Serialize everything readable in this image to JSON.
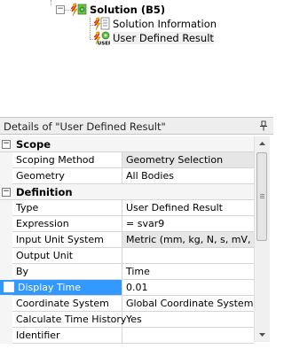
{
  "tree": {
    "solution_label": "Solution (B5)",
    "solution_info_label": "Solution Information",
    "user_result_label": "User Defined Result"
  },
  "details": {
    "title": "Details of \"User Defined Result\""
  },
  "categories": {
    "scope": "Scope",
    "definition": "Definition"
  },
  "rows": [
    {
      "property": "Scoping Method",
      "value": "Geometry Selection"
    },
    {
      "property": "Geometry",
      "value": "All Bodies"
    },
    {
      "property": "Type",
      "value": "User Defined Result"
    },
    {
      "property": "Expression",
      "value": "= svar9"
    },
    {
      "property": "Input Unit System",
      "value": "Metric (mm, kg, N, s, mV, ..."
    },
    {
      "property": "Output Unit",
      "value": ""
    },
    {
      "property": "By",
      "value": "Time"
    },
    {
      "property": "Display Time",
      "value": "0.01"
    },
    {
      "property": "Coordinate System",
      "value": "Global Coordinate System"
    },
    {
      "property": "Calculate Time History",
      "value": "Yes"
    },
    {
      "property": "Identifier",
      "value": ""
    }
  ],
  "icons": {
    "solution": "solution-icon",
    "solution_info": "solution-information-icon",
    "user_result": "user-defined-result-icon",
    "pin": "pin-icon"
  },
  "colors": {
    "selection": "#3399ff",
    "gray_cell": "#e6e6e6"
  }
}
